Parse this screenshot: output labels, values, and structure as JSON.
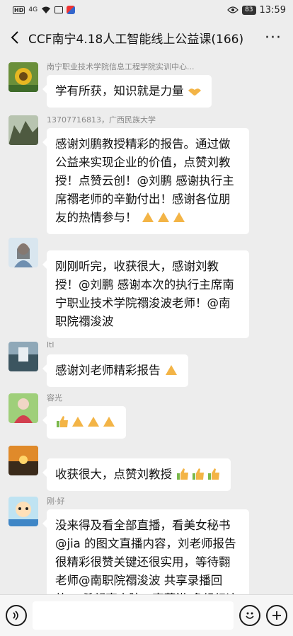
{
  "status_bar": {
    "network_badge": "HD",
    "signal": "4G",
    "battery": "83",
    "time": "13:59"
  },
  "chat": {
    "title": "CCF南宁4.18人工智能线上公益课(166)"
  },
  "messages": [
    {
      "sender": "南宁职业技术学院信息工程学院实训中心...",
      "text": "学有所获，知识就是力量",
      "emoji": [
        "handshake"
      ]
    },
    {
      "sender": "13707716813，广西民族大学",
      "text": "感谢刘鹏教授精彩的报告。通过做公益来实现企业的价值，点赞刘教授！点赞云创！@刘鹏  感谢执行主席禤老师的辛勤付出！感谢各位朋友的热情参与！",
      "emoji": [
        "pray",
        "pray",
        "pray"
      ]
    },
    {
      "sender": "",
      "text": "刚刚听完，收获很大，感谢刘教授！@刘鹏  感谢本次的执行主席南宁职业技术学院禤浚波老师！@南职院禤浚波",
      "emoji": []
    },
    {
      "sender": "ltl",
      "text": "感谢刘老师精彩报告",
      "emoji": [
        "pray"
      ]
    },
    {
      "sender": "容光",
      "text": "",
      "emoji": [
        "thumbsup",
        "pray",
        "pray",
        "pray"
      ]
    },
    {
      "sender": "",
      "text": "收获很大，点赞刘教授",
      "emoji": [
        "thumbsup",
        "thumbsup",
        "thumbsup"
      ]
    },
    {
      "sender": "刚·好",
      "text": "没来得及看全部直播，看美女秘书@jia 的图文直播内容，刘老师报告很精彩很赞关键还很实用，等待翾老师@南职院禤浚波 共享录播回放。 希望南方院@南蒋洪 多组织这",
      "emoji": []
    }
  ],
  "colors": {
    "background": "#ededed",
    "bubble": "#ffffff",
    "text": "#111111",
    "sender": "#888888"
  }
}
